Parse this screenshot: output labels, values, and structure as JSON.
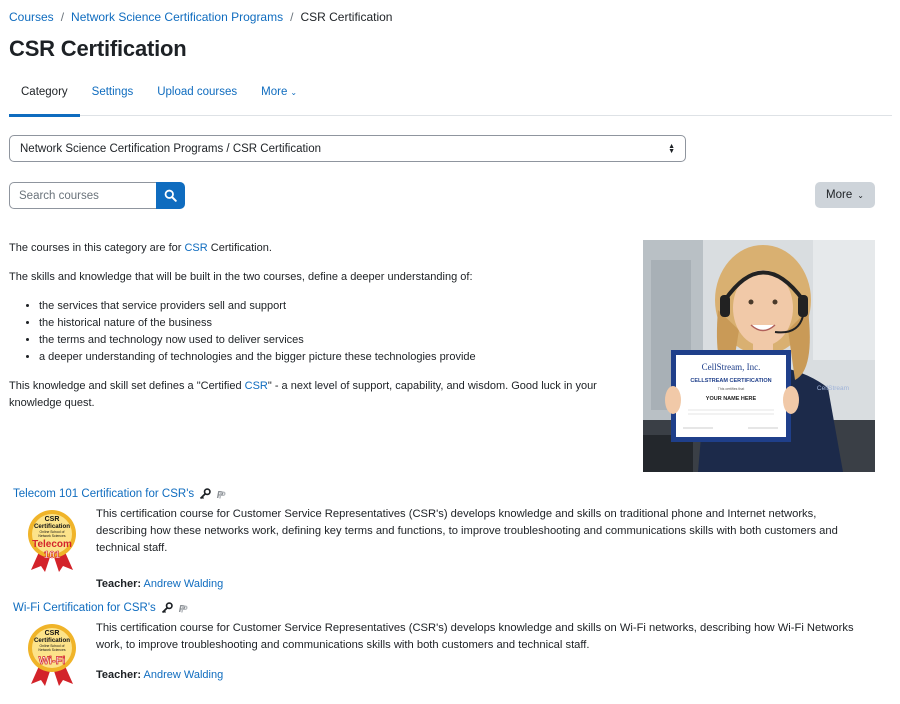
{
  "breadcrumb": [
    {
      "label": "Courses",
      "link": true
    },
    {
      "label": "Network Science Certification Programs",
      "link": true
    },
    {
      "label": "CSR Certification",
      "link": false
    }
  ],
  "page_title": "CSR Certification",
  "tabs": [
    {
      "label": "Category",
      "active": true
    },
    {
      "label": "Settings",
      "active": false
    },
    {
      "label": "Upload courses",
      "active": false
    },
    {
      "label": "More",
      "active": false
    }
  ],
  "category_select": {
    "value": "Network Science Certification Programs / CSR Certification"
  },
  "search": {
    "placeholder": "Search courses"
  },
  "more_button": {
    "label": "More"
  },
  "description": {
    "p1_before": "The courses in this category are for ",
    "p1_link": "CSR",
    "p1_after": " Certification.",
    "p2": "The skills and knowledge that will be built in the two courses, define a deeper understanding of:",
    "bullets": [
      "the services that service providers sell and support",
      "the historical nature of the business",
      "the terms and technology now used to deliver services",
      "a deeper understanding of technologies and the bigger picture these technologies provide"
    ],
    "p3_before": "This knowledge and skill set defines a \"Certified ",
    "p3_link": "CSR",
    "p3_after": "\" - a next level of support, capability, and wisdom.  Good luck in your knowledge quest."
  },
  "photo": {
    "certificate_company": "CellStream, Inc.",
    "certificate_heading": "CELLSTREAM CERTIFICATION",
    "certificate_sub": "This certifies that",
    "certificate_name": "YOUR NAME HERE",
    "shirt_logo": "CellStream"
  },
  "courses": [
    {
      "title": "Telecom 101 Certification for CSR's",
      "summary": "This certification course for Customer Service Representatives (CSR's) develops knowledge and skills on traditional phone and Internet networks, describing how these networks work, defining key terms and functions, to improve troubleshooting and communications skills with both customers and technical staff.",
      "teacher_label": "Teacher:",
      "teacher_name": "Andrew Walding",
      "badge_line1": "CSR",
      "badge_line2": "Certification",
      "badge_line3": "Online School of",
      "badge_line4": "Network Sciences",
      "badge_title": "Telecom",
      "badge_number": "101"
    },
    {
      "title": "Wi-Fi Certification for CSR's",
      "summary": "This certification course for Customer Service Representatives (CSR's) develops knowledge and skills on Wi-Fi networks, describing how Wi-Fi Networks work, to improve troubleshooting and communications skills with both customers and technical staff.",
      "teacher_label": "Teacher:",
      "teacher_name": "Andrew Walding",
      "badge_line1": "CSR",
      "badge_line2": "Certification",
      "badge_line3": "Online School of",
      "badge_line4": "Network Sciences",
      "badge_title": "Wi-Fi"
    }
  ],
  "icons": {
    "search": "search-icon",
    "key": "key-icon",
    "paypal": "paypal-icon",
    "chevron": "chevron-down-icon"
  },
  "colors": {
    "link": "#0f6cbf",
    "primary": "#0f6cbf",
    "more_bg": "#ced4da"
  }
}
